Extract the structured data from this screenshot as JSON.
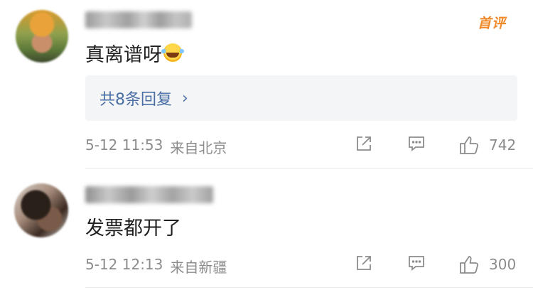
{
  "comments": [
    {
      "content": "真离谱呀",
      "badge": "首评",
      "replies_label": "共8条回复",
      "replies_chevron": "›",
      "time": "5-12 11:53",
      "location": "来自北京",
      "likes": "742"
    },
    {
      "content": "发票都开了",
      "time": "5-12 12:13",
      "location": "来自新疆",
      "likes": "300"
    }
  ],
  "icons": {
    "share": "share-icon",
    "reply": "comment-icon",
    "like": "thumbs-up-icon",
    "emoji": "laugh-cry-emoji"
  },
  "colors": {
    "badge": "#f08a2a",
    "link": "#4a6fa5",
    "meta": "#8c8c8c",
    "reply_box_bg": "#f4f5f7"
  }
}
